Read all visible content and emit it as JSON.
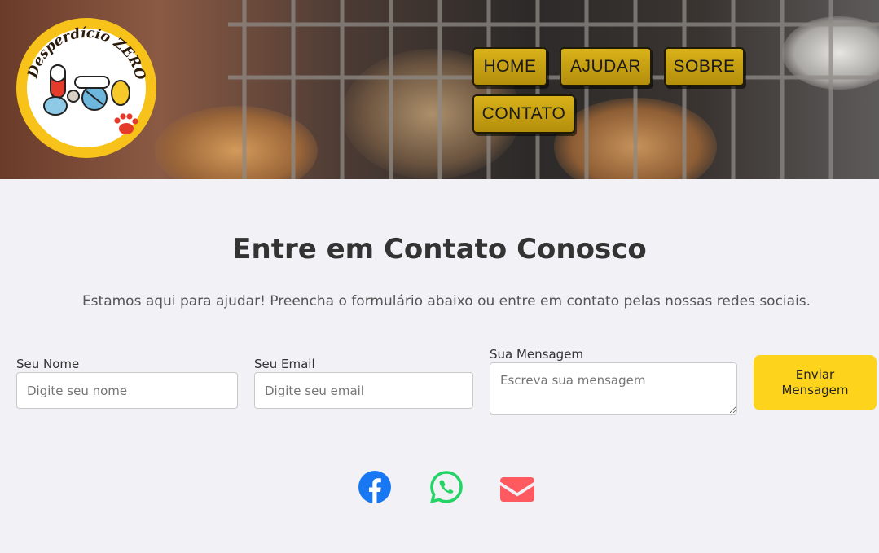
{
  "header": {
    "logo": {
      "text": "Desperdício ZERO",
      "colors": {
        "ring": "#f7c21a",
        "paw": "#e53b2b"
      }
    },
    "nav": [
      {
        "label": "HOME"
      },
      {
        "label": "AJUDAR"
      },
      {
        "label": "SOBRE"
      },
      {
        "label": "CONTATO"
      }
    ]
  },
  "contact": {
    "title": "Entre em Contato Conosco",
    "subtitle": "Estamos aqui para ajudar! Preencha o formulário abaixo ou entre em contato pelas nossas redes sociais.",
    "form": {
      "name": {
        "label": "Seu Nome",
        "placeholder": "Digite seu nome",
        "value": ""
      },
      "email": {
        "label": "Seu Email",
        "placeholder": "Digite seu email",
        "value": ""
      },
      "message": {
        "label": "Sua Mensagem",
        "placeholder": "Escreva sua mensagem",
        "value": ""
      },
      "submit_line1": "Enviar",
      "submit_line2": "Mensagem"
    },
    "social": [
      {
        "icon": "facebook-icon",
        "color": "#1877f2"
      },
      {
        "icon": "whatsapp-icon",
        "color": "#25d366"
      },
      {
        "icon": "email-icon",
        "color": "#ff5a5f"
      }
    ]
  },
  "colors": {
    "accent": "#fdd31b",
    "nav_button": "#c69f12",
    "background": "#f2f1f6"
  }
}
